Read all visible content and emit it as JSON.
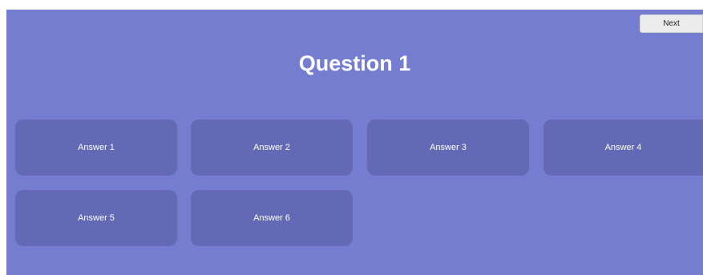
{
  "toolbar": {
    "next_label": "Next"
  },
  "question": {
    "title": "Question 1"
  },
  "answers": [
    {
      "label": "Answer 1"
    },
    {
      "label": "Answer 2"
    },
    {
      "label": "Answer 3"
    },
    {
      "label": "Answer 4"
    },
    {
      "label": "Answer 5"
    },
    {
      "label": "Answer 6"
    }
  ],
  "colors": {
    "background": "#757dd1",
    "answer_button": "#6369b4",
    "next_button": "#ececec",
    "text": "#ffffff"
  }
}
